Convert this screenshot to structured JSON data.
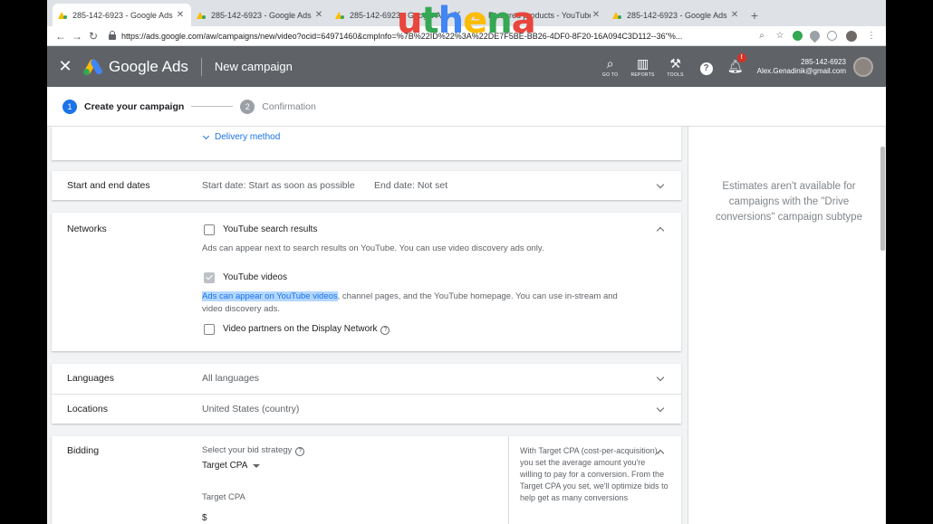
{
  "browser": {
    "tabs": [
      {
        "title": "285-142-6923 - Google Ads",
        "active": true
      },
      {
        "title": "285-142-6923 - Google Ads",
        "active": false
      },
      {
        "title": "285-142-6923 - Google Ads",
        "active": false
      },
      {
        "title": "Featured products - YouTube",
        "active": false
      },
      {
        "title": "285-142-6923 - Google Ads",
        "active": false
      }
    ],
    "new_tab_icon": "+",
    "url": "https://ads.google.com/aw/campaigns/new/video?ocid=64971460&cmpInfo=%7B%22ID%22%3A%22DE7F5BE-BB26-4DF0-8F20-16A094C3D112--36\"%..."
  },
  "header": {
    "brand": "Google Ads",
    "page_title": "New campaign",
    "tools": [
      {
        "icon": "search-icon",
        "label": "GO TO"
      },
      {
        "icon": "reports-icon",
        "label": "REPORTS"
      },
      {
        "icon": "wrench-icon",
        "label": "TOOLS"
      }
    ],
    "notification_count": "!",
    "account_id": "285-142-6923",
    "account_email": "Alex.Genadinik@gmail.com"
  },
  "stepper": {
    "steps": [
      {
        "number": "1",
        "label": "Create your campaign",
        "active": true
      },
      {
        "number": "2",
        "label": "Confirmation",
        "active": false
      }
    ]
  },
  "form": {
    "delivery_method_link": "Delivery method",
    "dates": {
      "label": "Start and end dates",
      "start": "Start date: Start as soon as possible",
      "end": "End date: Not set"
    },
    "networks": {
      "label": "Networks",
      "youtube_search": {
        "label": "YouTube search results",
        "checked": false,
        "desc": "Ads can appear next to search results on YouTube. You can use video discovery ads only."
      },
      "youtube_videos": {
        "label": "YouTube videos",
        "checked": true,
        "desc_highlight": "Ads can appear on YouTube videos",
        "desc_rest": ", channel pages, and the YouTube homepage. You can use in-stream and",
        "desc_line2": "video discovery ads."
      },
      "video_partners": {
        "label": "Video partners on the Display Network",
        "checked": false
      }
    },
    "languages": {
      "label": "Languages",
      "value": "All languages"
    },
    "locations": {
      "label": "Locations",
      "value": "United States (country)"
    },
    "bidding": {
      "label": "Bidding",
      "strategy_prompt": "Select your bid strategy",
      "strategy_value": "Target CPA",
      "target_label": "Target CPA",
      "currency": "$",
      "info": "With Target CPA (cost-per-acquisition), you set the average amount you're willing to pay for a conversion. From the Target CPA you set, we'll optimize bids to help get as many conversions"
    }
  },
  "sidebar": {
    "message": "Estimates aren't available for campaigns with the \"Drive conversions\" campaign subtype"
  },
  "watermark": {
    "letters": [
      "u",
      "t",
      "h",
      "e",
      "n",
      "a"
    ],
    "colors": [
      "#e8453c",
      "#34a853",
      "#4285f4",
      "#fbbc04",
      "#34a853",
      "#e8453c"
    ]
  }
}
